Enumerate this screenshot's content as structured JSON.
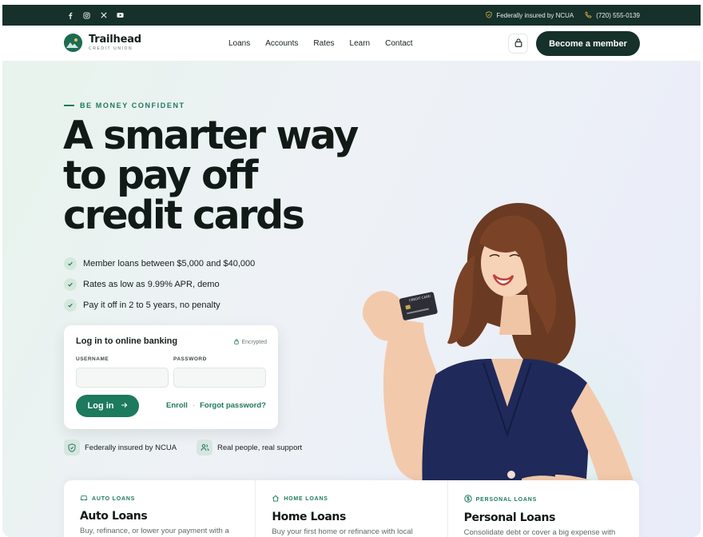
{
  "topbar": {
    "social_icons": [
      "facebook-icon",
      "instagram-icon",
      "x-icon",
      "youtube-icon"
    ],
    "insured_text": "Federally insured by NCUA",
    "phone": "(720) 555-0139"
  },
  "header": {
    "brand_name": "Trailhead",
    "brand_sub": "CREDIT UNION",
    "nav": [
      "Loans",
      "Accounts",
      "Rates",
      "Learn",
      "Contact"
    ],
    "cta_label": "Become a member"
  },
  "hero": {
    "eyebrow": "BE MONEY CONFIDENT",
    "headline": "A smarter way to pay off credit cards",
    "bullets": [
      "Member loans between $5,000 and $40,000",
      "Rates as low as 9.99% APR, demo",
      "Pay it off in 2 to 5 years, no penalty"
    ],
    "login": {
      "title": "Log in to online banking",
      "encrypted": "Encrypted",
      "username_label": "USERNAME",
      "password_label": "PASSWORD",
      "username_value": "",
      "password_value": "",
      "login_button": "Log in",
      "enroll": "Enroll",
      "separator": "·",
      "forgot": "Forgot password?"
    },
    "trust": [
      {
        "text": "Federally insured by NCUA",
        "icon": "shield-icon"
      },
      {
        "text": "Real people, real support",
        "icon": "people-icon"
      }
    ],
    "card_text": "CREDIT CARD"
  },
  "products": [
    {
      "category": "AUTO LOANS",
      "icon": "car-icon",
      "title": "Auto Loans",
      "desc": "Buy, refinance, or lower your payment with a"
    },
    {
      "category": "HOME LOANS",
      "icon": "home-icon",
      "title": "Home Loans",
      "desc": "Buy your first home or refinance with local"
    },
    {
      "category": "PERSONAL LOANS",
      "icon": "dollar-circle-icon",
      "title": "Personal Loans",
      "desc": "Consolidate debt or cover a big expense with"
    }
  ],
  "colors": {
    "dark_green": "#16302a",
    "accent_green": "#1d7a5c",
    "dress_navy": "#1f2a5a"
  }
}
